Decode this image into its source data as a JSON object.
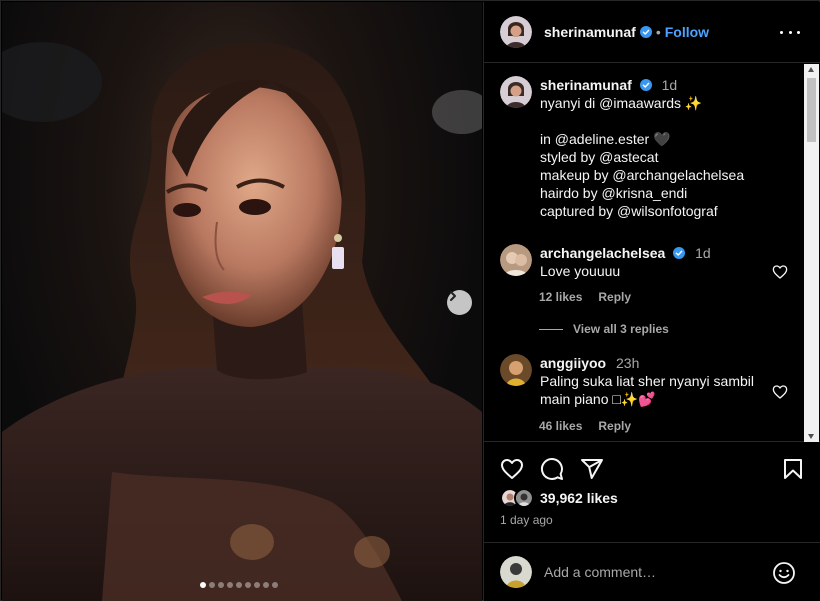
{
  "post": {
    "carousel": {
      "slide_count": 9,
      "active_index": 0
    },
    "author": {
      "username": "sherinamunaf",
      "verified": true,
      "follow_label": "Follow",
      "bullet": "•"
    },
    "caption": {
      "username": "sherinamunaf",
      "time": "1d",
      "lines": [
        "nyanyi di @imaawards ✨",
        "",
        "in @adeline.ester 🖤",
        "styled by @astecat",
        "makeup by @archangelachelsea",
        "hairdo by @krisna_endi",
        "captured by @wilsonfotograf"
      ]
    },
    "comments": [
      {
        "username": "archangelachelsea",
        "verified": true,
        "time": "1d",
        "text": "Love youuuu",
        "likes": "12 likes",
        "reply_label": "Reply",
        "view_replies": "View all 3 replies"
      },
      {
        "username": "anggiiyoo",
        "verified": false,
        "time": "23h",
        "text": "Paling suka liat sher nyanyi sambil main piano □✨💕",
        "likes": "46 likes",
        "reply_label": "Reply"
      }
    ],
    "likes": "39,962 likes",
    "posted_ago": "1 day ago",
    "add_comment": {
      "placeholder": "Add a comment…"
    },
    "colors": {
      "accent": "#4da3ff",
      "verified": "#3897f0",
      "muted": "#a8a8a8",
      "background": "#000000"
    },
    "icons": [
      "more-icon",
      "verified-badge-icon",
      "heart-icon",
      "comment-icon",
      "share-icon",
      "save-icon",
      "emoji-icon",
      "chevron-right-icon"
    ]
  }
}
